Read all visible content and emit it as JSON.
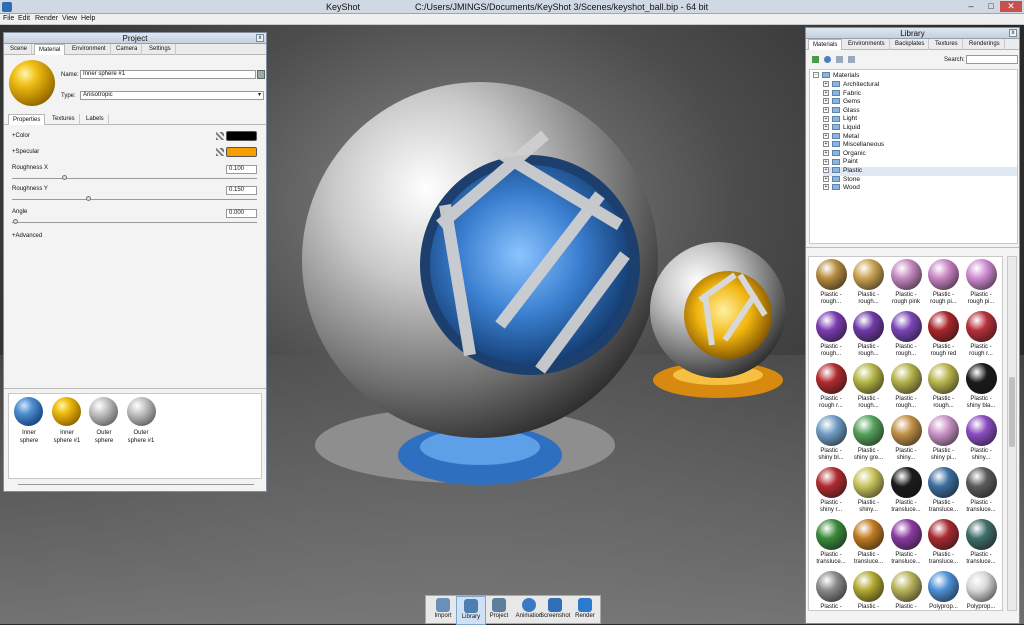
{
  "window": {
    "app": "KeyShot",
    "path": "C:/Users/JMINGS/Documents/KeyShot 3/Scenes/keyshot_ball.bip  -  64 bit"
  },
  "menu": [
    "File",
    "Edit",
    "Render",
    "View",
    "Help"
  ],
  "project": {
    "title": "Project",
    "tabs": [
      "Scene",
      "Material",
      "Environment",
      "Camera",
      "Settings"
    ],
    "active_tab": "Material",
    "name_label": "Name:",
    "name_value": "Inner sphere #1",
    "type_label": "Type:",
    "type_value": "Anisotropic",
    "subtabs": [
      "Properties",
      "Textures",
      "Labels"
    ],
    "color_label": "Color",
    "color_value": "#000000",
    "specular_label": "Specular",
    "specular_value": "#f5a000",
    "roughness_x_label": "Roughness X",
    "roughness_x_value": "0.100",
    "roughness_y_label": "Roughness Y",
    "roughness_y_value": "0.150",
    "angle_label": "Angle",
    "angle_value": "0.000",
    "advanced_label": "Advanced",
    "thumbs": [
      {
        "line1": "Inner",
        "line2": "sphere",
        "material": "blue"
      },
      {
        "line1": "Inner",
        "line2": "sphere #1",
        "material": "gold"
      },
      {
        "line1": "Outer",
        "line2": "sphere",
        "material": "silver"
      },
      {
        "line1": "Outer",
        "line2": "sphere #1",
        "material": "silver"
      }
    ]
  },
  "library": {
    "title": "Library",
    "tabs": [
      "Materials",
      "Environments",
      "Backplates",
      "Textures",
      "Renderings"
    ],
    "active_tab": "Materials",
    "search_label": "Search:",
    "root": "Materials",
    "tree": [
      "Architectural",
      "Fabric",
      "Gems",
      "Glass",
      "Light",
      "Liquid",
      "Metal",
      "Miscellaneous",
      "Organic",
      "Paint",
      "Plastic",
      "Stone",
      "Wood"
    ],
    "selected": "Plastic",
    "materials": [
      {
        "l1": "Plastic -",
        "l2": "rough...",
        "c": "#b58a3e"
      },
      {
        "l1": "Plastic -",
        "l2": "rough...",
        "c": "#c9a150"
      },
      {
        "l1": "Plastic -",
        "l2": "rough pink",
        "c": "#c488c0"
      },
      {
        "l1": "Plastic -",
        "l2": "rough pi...",
        "c": "#c884c4"
      },
      {
        "l1": "Plastic -",
        "l2": "rough pi...",
        "c": "#cf8ad0"
      },
      {
        "l1": "Plastic -",
        "l2": "rough...",
        "c": "#7a3cb0"
      },
      {
        "l1": "Plastic -",
        "l2": "rough...",
        "c": "#6e3aa8"
      },
      {
        "l1": "Plastic -",
        "l2": "rough...",
        "c": "#7845b5"
      },
      {
        "l1": "Plastic -",
        "l2": "rough red",
        "c": "#a8252a"
      },
      {
        "l1": "Plastic -",
        "l2": "rough r...",
        "c": "#b5303a"
      },
      {
        "l1": "Plastic -",
        "l2": "rough r...",
        "c": "#b02a2e"
      },
      {
        "l1": "Plastic -",
        "l2": "rough...",
        "c": "#b5b545"
      },
      {
        "l1": "Plastic -",
        "l2": "rough...",
        "c": "#b4b14a"
      },
      {
        "l1": "Plastic -",
        "l2": "rough...",
        "c": "#b8b54c"
      },
      {
        "l1": "Plastic -",
        "l2": "shiny bla...",
        "c": "#1a1a1a"
      },
      {
        "l1": "Plastic -",
        "l2": "shiny bl...",
        "c": "#6f9bc4"
      },
      {
        "l1": "Plastic -",
        "l2": "shiny gre...",
        "c": "#55a05a"
      },
      {
        "l1": "Plastic -",
        "l2": "shiny...",
        "c": "#c18f45"
      },
      {
        "l1": "Plastic -",
        "l2": "shiny pi...",
        "c": "#c994c6"
      },
      {
        "l1": "Plastic -",
        "l2": "shiny...",
        "c": "#8a4cc0"
      },
      {
        "l1": "Plastic -",
        "l2": "shiny r...",
        "c": "#b02a30"
      },
      {
        "l1": "Plastic -",
        "l2": "shiny...",
        "c": "#c7c25a"
      },
      {
        "l1": "Plastic -",
        "l2": "transluce...",
        "c": "#1b1b1b"
      },
      {
        "l1": "Plastic -",
        "l2": "transluce...",
        "c": "#3c6e9e"
      },
      {
        "l1": "Plastic -",
        "l2": "transluce...",
        "c": "#5b5b5b"
      },
      {
        "l1": "Plastic -",
        "l2": "transluce...",
        "c": "#3b8a3b"
      },
      {
        "l1": "Plastic -",
        "l2": "transluce...",
        "c": "#c07a20"
      },
      {
        "l1": "Plastic -",
        "l2": "transluce...",
        "c": "#8a3aa0"
      },
      {
        "l1": "Plastic -",
        "l2": "transluce...",
        "c": "#a82a30"
      },
      {
        "l1": "Plastic -",
        "l2": "transluce...",
        "c": "#3f6e6a"
      },
      {
        "l1": "Plastic -",
        "l2": "",
        "c": "#8a8a8a"
      },
      {
        "l1": "Plastic -",
        "l2": "",
        "c": "#b0a830"
      },
      {
        "l1": "Plastic -",
        "l2": "",
        "c": "#b8b25a"
      },
      {
        "l1": "Polyprop...",
        "l2": "",
        "c": "#4d8fd6"
      },
      {
        "l1": "Polyprop...",
        "l2": "",
        "c": "#d8d8d8"
      }
    ]
  },
  "toolbar": [
    {
      "label": "Import",
      "icon": "import-icon"
    },
    {
      "label": "Library",
      "icon": "library-icon"
    },
    {
      "label": "Project",
      "icon": "project-icon"
    },
    {
      "label": "Animation",
      "icon": "animation-icon"
    },
    {
      "label": "Screenshot",
      "icon": "screenshot-icon"
    },
    {
      "label": "Render",
      "icon": "render-icon"
    }
  ],
  "active_tool": "Library"
}
